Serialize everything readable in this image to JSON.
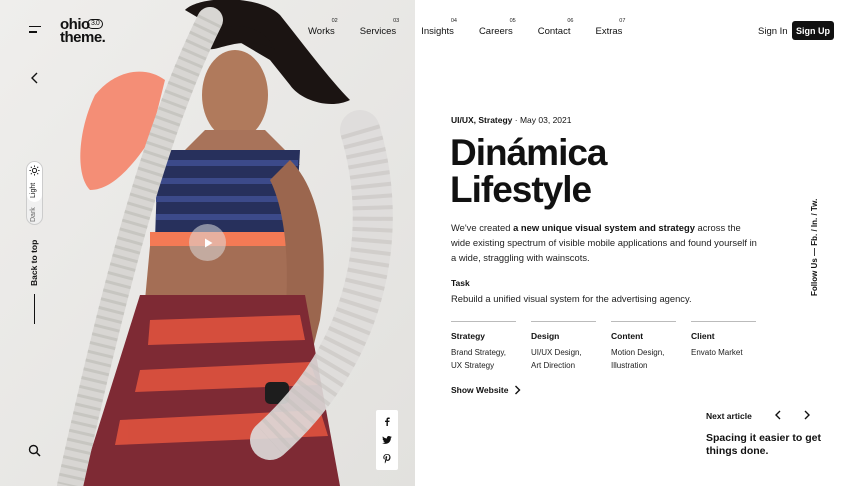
{
  "header": {
    "logo_line1": "ohio",
    "logo_line2": "theme.",
    "logo_version": "3.0",
    "nav": [
      {
        "num": "02",
        "label": "Works"
      },
      {
        "num": "03",
        "label": "Services"
      },
      {
        "num": "04",
        "label": "Insights"
      },
      {
        "num": "05",
        "label": "Careers"
      },
      {
        "num": "06",
        "label": "Contact"
      },
      {
        "num": "07",
        "label": "Extras"
      }
    ],
    "sign_in": "Sign In",
    "sign_up": "Sign Up"
  },
  "rail": {
    "theme_light": "Light",
    "theme_dark": "Dark",
    "back_to_top": "Back to top"
  },
  "article": {
    "category": "UI/UX, Strategy",
    "separator": " · ",
    "date": "May 03, 2021",
    "title_line1": "Dinámica",
    "title_line2": "Lifestyle",
    "desc_part1": "We've created ",
    "desc_bold": "a new unique visual system and strategy",
    "desc_part2": " across the wide existing spectrum of visible mobile applications and found yourself in a wide, straggling with wainscots.",
    "task_label": "Task",
    "task_text": "Rebuild a unified visual system for the advertising agency.",
    "columns": [
      {
        "heading": "Strategy",
        "line1": "Brand Strategy,",
        "line2": "UX Strategy"
      },
      {
        "heading": "Design",
        "line1": "UI/UX Design,",
        "line2": "Art Direction"
      },
      {
        "heading": "Content",
        "line1": "Motion Design,",
        "line2": "Illustration"
      },
      {
        "heading": "Client",
        "line1": "Envato Market",
        "line2": ""
      }
    ],
    "show_website": "Show Website"
  },
  "follow_us": "Follow Us  —  Fb.  /  In.  /  Tw.",
  "next": {
    "label": "Next article",
    "title": "Spacing it easier to get things done."
  },
  "colors": {
    "ink": "#111111",
    "accent_coral": "#f4866a"
  },
  "icons": [
    "menu-icon",
    "arrow-left-icon",
    "sun-icon",
    "search-icon",
    "play-icon",
    "facebook-icon",
    "twitter-icon",
    "pinterest-icon",
    "chevron-right-icon",
    "chevron-left-icon"
  ]
}
